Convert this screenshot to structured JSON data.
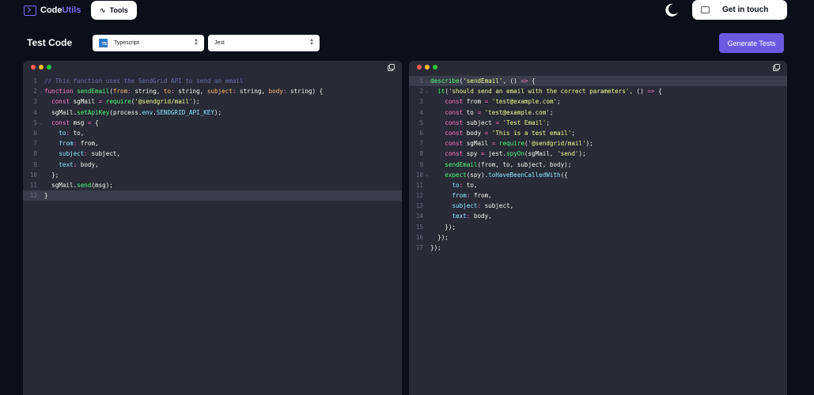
{
  "nav": {
    "logo_code": "Code",
    "logo_utils": "Utils",
    "tools_label": "Tools",
    "tools_icon": "wave-icon",
    "theme_icon": "moon-icon",
    "contact_label": "Get in touch",
    "contact_icon": "inbox-icon"
  },
  "toolbar": {
    "title": "Test Code",
    "language": {
      "badge": "TS",
      "value": "Typescript"
    },
    "framework": {
      "value": "Jest"
    },
    "generate_label": "Generate Tests"
  },
  "colors": {
    "background": "#0b0f1a",
    "editor_bg": "#282a36",
    "accent": "#6a5ae0",
    "comment": "#6272a4",
    "keyword": "#ff79c6",
    "function": "#50fa7b",
    "param": "#ffb86c",
    "string": "#f1fa8c",
    "type": "#8be9fd"
  },
  "source_editor": {
    "active_line": 12,
    "lines": [
      {
        "n": "1",
        "fold": "",
        "tokens": [
          [
            "c",
            "// This function uses the SendGrid API to send an email"
          ]
        ]
      },
      {
        "n": "2",
        "fold": "⌄",
        "tokens": [
          [
            "k",
            "function "
          ],
          [
            "f",
            "sendEmail"
          ],
          [
            "x",
            "("
          ],
          [
            "p",
            "from"
          ],
          [
            "k",
            ": "
          ],
          [
            "x",
            "string, "
          ],
          [
            "p",
            "to"
          ],
          [
            "k",
            ": "
          ],
          [
            "x",
            "string, "
          ],
          [
            "p",
            "subject"
          ],
          [
            "k",
            ": "
          ],
          [
            "x",
            "string, "
          ],
          [
            "p",
            "body"
          ],
          [
            "k",
            ": "
          ],
          [
            "x",
            "string) {"
          ]
        ]
      },
      {
        "n": "3",
        "fold": "",
        "tokens": [
          [
            "x",
            "  "
          ],
          [
            "k",
            "const "
          ],
          [
            "x",
            "sgMail "
          ],
          [
            "k",
            "= "
          ],
          [
            "f",
            "require"
          ],
          [
            "x",
            "("
          ],
          [
            "s",
            "'@sendgrid/mail'"
          ],
          [
            "x",
            ");"
          ]
        ]
      },
      {
        "n": "4",
        "fold": "",
        "tokens": [
          [
            "x",
            "  sgMail."
          ],
          [
            "f",
            "setApiKey"
          ],
          [
            "x",
            "(process."
          ],
          [
            "t",
            "env"
          ],
          [
            "x",
            "."
          ],
          [
            "t",
            "SENDGRID_API_KEY"
          ],
          [
            "x",
            ");"
          ]
        ]
      },
      {
        "n": "5",
        "fold": "⌄",
        "tokens": [
          [
            "x",
            "  "
          ],
          [
            "k",
            "const "
          ],
          [
            "x",
            "msg "
          ],
          [
            "k",
            "= "
          ],
          [
            "x",
            "{"
          ]
        ]
      },
      {
        "n": "6",
        "fold": "",
        "tokens": [
          [
            "x",
            "    "
          ],
          [
            "t",
            "to"
          ],
          [
            "k",
            ": "
          ],
          [
            "x",
            "to,"
          ]
        ]
      },
      {
        "n": "7",
        "fold": "",
        "tokens": [
          [
            "x",
            "    "
          ],
          [
            "t",
            "from"
          ],
          [
            "k",
            ": "
          ],
          [
            "x",
            "from,"
          ]
        ]
      },
      {
        "n": "8",
        "fold": "",
        "tokens": [
          [
            "x",
            "    "
          ],
          [
            "t",
            "subject"
          ],
          [
            "k",
            ": "
          ],
          [
            "x",
            "subject,"
          ]
        ]
      },
      {
        "n": "9",
        "fold": "",
        "tokens": [
          [
            "x",
            "    "
          ],
          [
            "t",
            "text"
          ],
          [
            "k",
            ": "
          ],
          [
            "x",
            "body,"
          ]
        ]
      },
      {
        "n": "10",
        "fold": "",
        "tokens": [
          [
            "x",
            "  };"
          ]
        ]
      },
      {
        "n": "11",
        "fold": "",
        "tokens": [
          [
            "x",
            "  sgMail."
          ],
          [
            "f",
            "send"
          ],
          [
            "x",
            "(msg);"
          ]
        ]
      },
      {
        "n": "12",
        "fold": "",
        "tokens": [
          [
            "x",
            "}"
          ]
        ]
      }
    ]
  },
  "test_editor": {
    "active_line": 1,
    "lines": [
      {
        "n": "1",
        "fold": "⌄",
        "tokens": [
          [
            "f",
            "describe"
          ],
          [
            "x",
            "("
          ],
          [
            "s",
            "'sendEmail'"
          ],
          [
            "x",
            ", () "
          ],
          [
            "k",
            "=>"
          ],
          [
            "x",
            " {"
          ]
        ]
      },
      {
        "n": "2",
        "fold": "⌄",
        "tokens": [
          [
            "x",
            "  "
          ],
          [
            "f",
            "it"
          ],
          [
            "x",
            "("
          ],
          [
            "s",
            "'should send an email with the correct parameters'"
          ],
          [
            "x",
            ", () "
          ],
          [
            "k",
            "=>"
          ],
          [
            "x",
            " {"
          ]
        ]
      },
      {
        "n": "3",
        "fold": "",
        "tokens": [
          [
            "x",
            "    "
          ],
          [
            "k",
            "const "
          ],
          [
            "x",
            "from "
          ],
          [
            "k",
            "= "
          ],
          [
            "s",
            "'test@example.com'"
          ],
          [
            "x",
            ";"
          ]
        ]
      },
      {
        "n": "4",
        "fold": "",
        "tokens": [
          [
            "x",
            "    "
          ],
          [
            "k",
            "const "
          ],
          [
            "x",
            "to "
          ],
          [
            "k",
            "= "
          ],
          [
            "s",
            "'test@example.com'"
          ],
          [
            "x",
            ";"
          ]
        ]
      },
      {
        "n": "5",
        "fold": "",
        "tokens": [
          [
            "x",
            "    "
          ],
          [
            "k",
            "const "
          ],
          [
            "x",
            "subject "
          ],
          [
            "k",
            "= "
          ],
          [
            "s",
            "'Test Email'"
          ],
          [
            "x",
            ";"
          ]
        ]
      },
      {
        "n": "6",
        "fold": "",
        "tokens": [
          [
            "x",
            "    "
          ],
          [
            "k",
            "const "
          ],
          [
            "x",
            "body "
          ],
          [
            "k",
            "= "
          ],
          [
            "s",
            "'This is a test email'"
          ],
          [
            "x",
            ";"
          ]
        ]
      },
      {
        "n": "7",
        "fold": "",
        "tokens": [
          [
            "x",
            "    "
          ],
          [
            "k",
            "const "
          ],
          [
            "x",
            "sgMail "
          ],
          [
            "k",
            "= "
          ],
          [
            "f",
            "require"
          ],
          [
            "x",
            "("
          ],
          [
            "s",
            "'@sendgrid/mail'"
          ],
          [
            "x",
            ");"
          ]
        ]
      },
      {
        "n": "8",
        "fold": "",
        "tokens": [
          [
            "x",
            "    "
          ],
          [
            "k",
            "const "
          ],
          [
            "x",
            "spy "
          ],
          [
            "k",
            "= "
          ],
          [
            "x",
            "jest."
          ],
          [
            "f",
            "spyOn"
          ],
          [
            "x",
            "(sgMail, "
          ],
          [
            "s",
            "'send'"
          ],
          [
            "x",
            ");"
          ]
        ]
      },
      {
        "n": "9",
        "fold": "",
        "tokens": [
          [
            "x",
            "    "
          ],
          [
            "f",
            "sendEmail"
          ],
          [
            "x",
            "(from, to, subject, body);"
          ]
        ]
      },
      {
        "n": "10",
        "fold": "⌄",
        "tokens": [
          [
            "x",
            "    "
          ],
          [
            "f",
            "expect"
          ],
          [
            "x",
            "(spy)."
          ],
          [
            "t",
            "toHaveBeenCalledWith"
          ],
          [
            "x",
            "({"
          ]
        ]
      },
      {
        "n": "11",
        "fold": "",
        "tokens": [
          [
            "x",
            "      "
          ],
          [
            "t",
            "to"
          ],
          [
            "k",
            ": "
          ],
          [
            "x",
            "to,"
          ]
        ]
      },
      {
        "n": "12",
        "fold": "",
        "tokens": [
          [
            "x",
            "      "
          ],
          [
            "t",
            "from"
          ],
          [
            "k",
            ": "
          ],
          [
            "x",
            "from,"
          ]
        ]
      },
      {
        "n": "13",
        "fold": "",
        "tokens": [
          [
            "x",
            "      "
          ],
          [
            "t",
            "subject"
          ],
          [
            "k",
            ": "
          ],
          [
            "x",
            "subject,"
          ]
        ]
      },
      {
        "n": "14",
        "fold": "",
        "tokens": [
          [
            "x",
            "      "
          ],
          [
            "t",
            "text"
          ],
          [
            "k",
            ": "
          ],
          [
            "x",
            "body,"
          ]
        ]
      },
      {
        "n": "15",
        "fold": "",
        "tokens": [
          [
            "x",
            "    });"
          ]
        ]
      },
      {
        "n": "16",
        "fold": "",
        "tokens": [
          [
            "x",
            "  });"
          ]
        ]
      },
      {
        "n": "17",
        "fold": "",
        "tokens": [
          [
            "x",
            "});"
          ]
        ]
      }
    ]
  }
}
